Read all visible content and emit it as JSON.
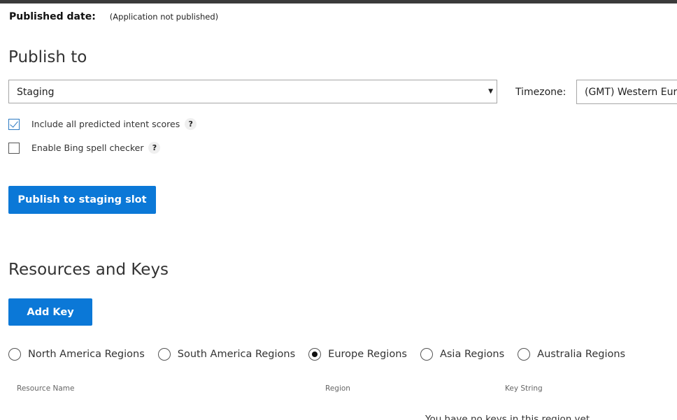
{
  "header": {
    "published_label": "Published date:",
    "published_value": "(Application not published)"
  },
  "publish": {
    "title": "Publish to",
    "slot_select_value": "Staging",
    "timezone_label": "Timezone:",
    "timezone_value": "(GMT) Western Europe Time",
    "options": [
      {
        "label": "Include all predicted intent scores",
        "checked": true
      },
      {
        "label": "Enable Bing spell checker",
        "checked": false
      }
    ],
    "help_glyph": "?",
    "publish_button": "Publish to staging slot"
  },
  "resources": {
    "title": "Resources and Keys",
    "add_key_button": "Add Key",
    "regions": [
      {
        "label": "North America Regions",
        "selected": false
      },
      {
        "label": "South America Regions",
        "selected": false
      },
      {
        "label": "Europe Regions",
        "selected": true
      },
      {
        "label": "Asia Regions",
        "selected": false
      },
      {
        "label": "Australia Regions",
        "selected": false
      }
    ],
    "columns": [
      "Resource Name",
      "Region",
      "Key String"
    ],
    "empty_message": "You have no keys in this region yet"
  },
  "colors": {
    "accent": "#0b78d7",
    "checkbox_accent": "#2b79c2",
    "topbar": "#3b3b3b"
  },
  "icons": {
    "dropdown": "caret-down-icon",
    "help": "question-icon",
    "check": "checkmark-icon"
  }
}
